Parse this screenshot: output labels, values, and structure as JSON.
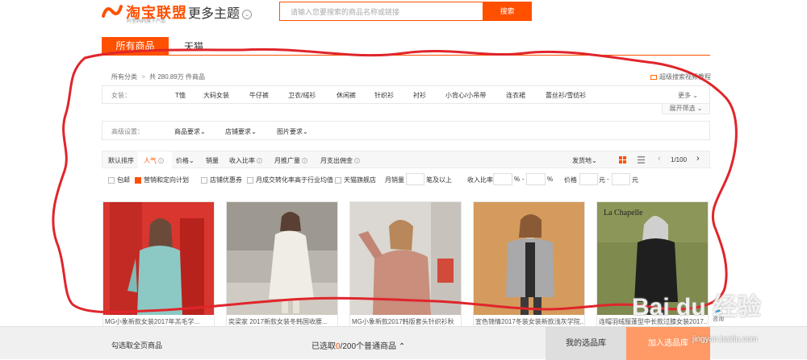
{
  "header": {
    "logo_name": "淘宝联盟",
    "logo_sub": "阿里妈妈旗下产品",
    "theme_label": "更多主题",
    "search_placeholder": "请输入您要搜索的商品名称或链接",
    "search_button": "搜索"
  },
  "tabs": [
    {
      "label": "所有商品",
      "active": true
    },
    {
      "label": "天猫",
      "active": false
    }
  ],
  "breadcrumb": {
    "root": "所有分类",
    "separator": ">",
    "count": "共 280.89万 件商品",
    "tutorial": "超级搜索视频教程"
  },
  "category": {
    "label": "女装：",
    "items": [
      "T恤",
      "大码女装",
      "牛仔裤",
      "卫衣/绒衫",
      "休闲裤",
      "针织衫",
      "衬衫",
      "小背心/小吊带",
      "连衣裙",
      "蕾丝衫/雪纺衫"
    ],
    "more": "更多",
    "expand": "展开筛选"
  },
  "advanced": {
    "label": "高级设置：",
    "dropdowns": [
      "商品要求",
      "店铺要求",
      "图片要求"
    ]
  },
  "sort": {
    "items": [
      "默认排序",
      "人气",
      "价格",
      "销量",
      "收入比率",
      "月推广量",
      "月支出佣金"
    ],
    "active": "人气",
    "shipping": "发货地",
    "page": "1/100"
  },
  "filters": {
    "checkboxes": [
      {
        "label": "包邮",
        "checked": false
      },
      {
        "label": "营销和定向计划",
        "checked": true
      },
      {
        "label": "店铺优惠券",
        "checked": false
      },
      {
        "label": "月成交转化率高于行业均值",
        "checked": false
      },
      {
        "label": "天猫旗舰店",
        "checked": false
      }
    ],
    "monthly_sales_label": "月销量",
    "monthly_sales_suffix": "笔及以上",
    "income_label": "收入比率",
    "percent": "%",
    "dash": "-",
    "price_label": "价格",
    "yuan": "元"
  },
  "products": [
    {
      "title": "MG小象新款女装2017年羔毛学..."
    },
    {
      "title": "奕梁家 2017新款女装冬韩国收腰..."
    },
    {
      "title": "MG小象新款2017韩版套头针织衫秋"
    },
    {
      "title": "宣色锦情2017冬装女装新款浅灰学院..."
    },
    {
      "title": "连帽羽绒服蓬型中长款过膝女装2017..."
    }
  ],
  "bottom": {
    "select_all": "勾选取全页商品",
    "selected_prefix": "已选取",
    "selected_num": "0",
    "selected_suffix": "/200个普通商品",
    "library": "我的选品库",
    "add": "加入选品库",
    "help": "咨询"
  },
  "watermark": {
    "text": "Bai du 经验",
    "url": "jingyan.baidu.com"
  },
  "colors": {
    "accent": "#ff5000",
    "annotation": "#e0252b"
  }
}
